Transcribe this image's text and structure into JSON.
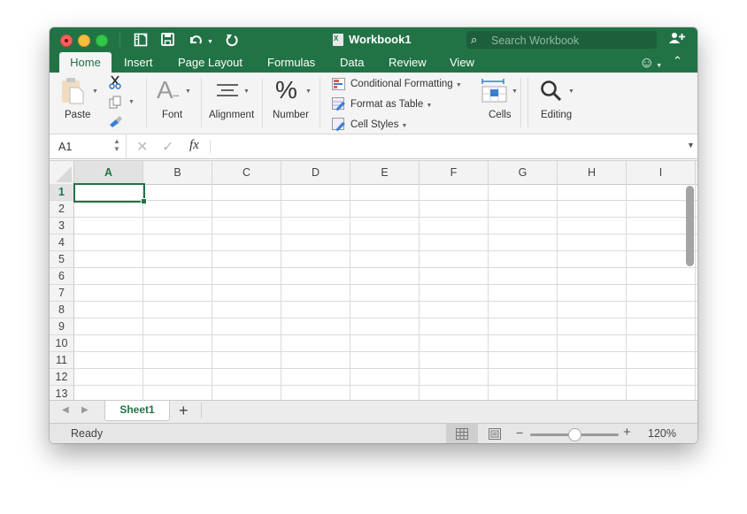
{
  "window": {
    "title": "Workbook1",
    "search_placeholder": "Search Workbook"
  },
  "quick_access": [
    "sidebar-icon",
    "save-icon",
    "undo-icon",
    "redo-icon"
  ],
  "tabs": [
    {
      "label": "Home",
      "active": true
    },
    {
      "label": "Insert"
    },
    {
      "label": "Page Layout"
    },
    {
      "label": "Formulas"
    },
    {
      "label": "Data"
    },
    {
      "label": "Review"
    },
    {
      "label": "View"
    }
  ],
  "ribbon": {
    "paste": "Paste",
    "font": "Font",
    "alignment": "Alignment",
    "number": "Number",
    "conditional_formatting": "Conditional Formatting",
    "format_as_table": "Format as Table",
    "cell_styles": "Cell Styles",
    "cells": "Cells",
    "editing": "Editing"
  },
  "formula_bar": {
    "name_box": "A1",
    "fx": "fx",
    "formula": ""
  },
  "grid": {
    "columns": [
      "A",
      "B",
      "C",
      "D",
      "E",
      "F",
      "G",
      "H",
      "I"
    ],
    "rows": [
      "1",
      "2",
      "3",
      "4",
      "5",
      "6",
      "7",
      "8",
      "9",
      "10",
      "11",
      "12",
      "13"
    ],
    "selected_cell": "A1"
  },
  "sheets": [
    {
      "label": "Sheet1",
      "active": true
    }
  ],
  "status": {
    "text": "Ready",
    "zoom": "120%",
    "zoom_value": 120
  },
  "colors": {
    "brand": "#217346",
    "ribbon_bg": "#f4f4f4"
  }
}
